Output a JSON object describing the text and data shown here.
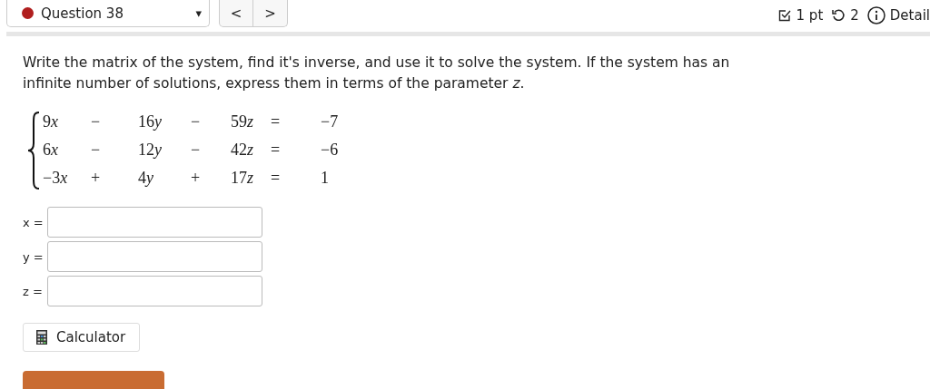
{
  "header": {
    "question": "Question 38",
    "correct": false,
    "dropdown_icon": "▾",
    "prev": "<",
    "next": ">",
    "points": "1 pt",
    "attempts": "2",
    "details": "Detail"
  },
  "prompt": "Write the matrix of the system, find it's inverse, and use it to solve the system. If the system has an infinite number of solutions, express them in terms of the parameter *z*.",
  "equations": [
    {
      "terms": [
        {
          "coef": "9",
          "var": "x"
        },
        {
          "coef": "16",
          "var": "y"
        },
        {
          "coef": "59",
          "var": "z"
        }
      ],
      "ops": [
        "−",
        "−"
      ],
      "equals": "=",
      "rhs": "−7"
    },
    {
      "terms": [
        {
          "coef": "6",
          "var": "x"
        },
        {
          "coef": "12",
          "var": "y"
        },
        {
          "coef": "42",
          "var": "z"
        }
      ],
      "ops": [
        "−",
        "−"
      ],
      "equals": "=",
      "rhs": "−6"
    },
    {
      "terms": [
        {
          "coef": "−3",
          "var": "x"
        },
        {
          "coef": "4",
          "var": "y"
        },
        {
          "coef": "17",
          "var": "z"
        }
      ],
      "ops": [
        "+",
        "+"
      ],
      "equals": "=",
      "rhs": "1"
    }
  ],
  "answers": [
    {
      "label": "x ="
    },
    {
      "label": "y ="
    },
    {
      "label": "z ="
    }
  ],
  "calculator": "Calculator"
}
